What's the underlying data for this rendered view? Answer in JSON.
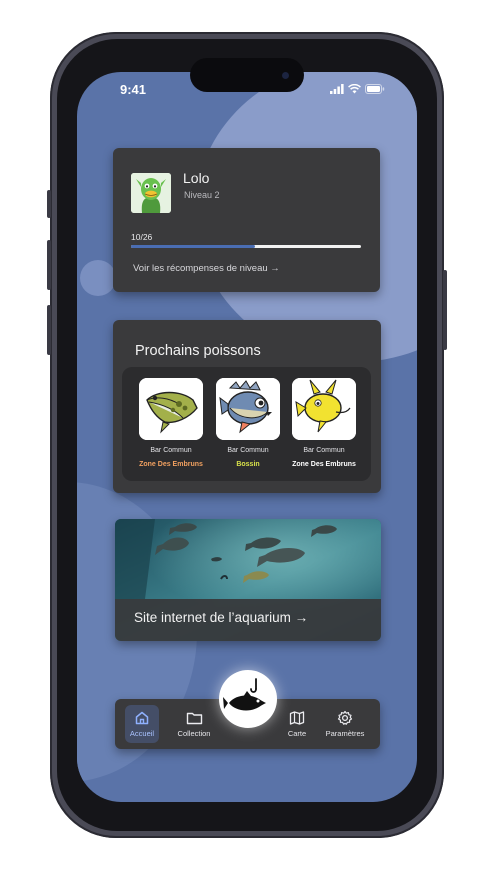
{
  "status_bar": {
    "time": "9:41"
  },
  "profile": {
    "name": "Lolo",
    "level": "Niveau 2",
    "progress_text": "10/26",
    "progress": 0.54,
    "rewards_link": "Voir les récompenses de niveau →"
  },
  "upcoming": {
    "title": "Prochains poissons",
    "fish": [
      {
        "name": "Bar Commun",
        "zone": "Zone Des Embruns",
        "zone_color": "#f0a060"
      },
      {
        "name": "Bar Commun",
        "zone": "Bossin",
        "zone_color": "#d8e14a"
      },
      {
        "name": "Bar Commun",
        "zone": "Zone Des Embruns",
        "zone_color": "#ffffff"
      }
    ]
  },
  "aquarium": {
    "label": "Site internet de l’aquarium →"
  },
  "nav": {
    "home": "Accueil",
    "collection": "Collection",
    "map": "Carte",
    "settings": "Paramètres"
  },
  "colors": {
    "background": "#5a73a8",
    "card": "#3a3a3c",
    "accent": "#4a6db3"
  },
  "icons": [
    "signal-icon",
    "wifi-icon",
    "battery-icon",
    "home-icon",
    "folder-icon",
    "map-icon",
    "gear-icon",
    "fish-hook-icon"
  ]
}
